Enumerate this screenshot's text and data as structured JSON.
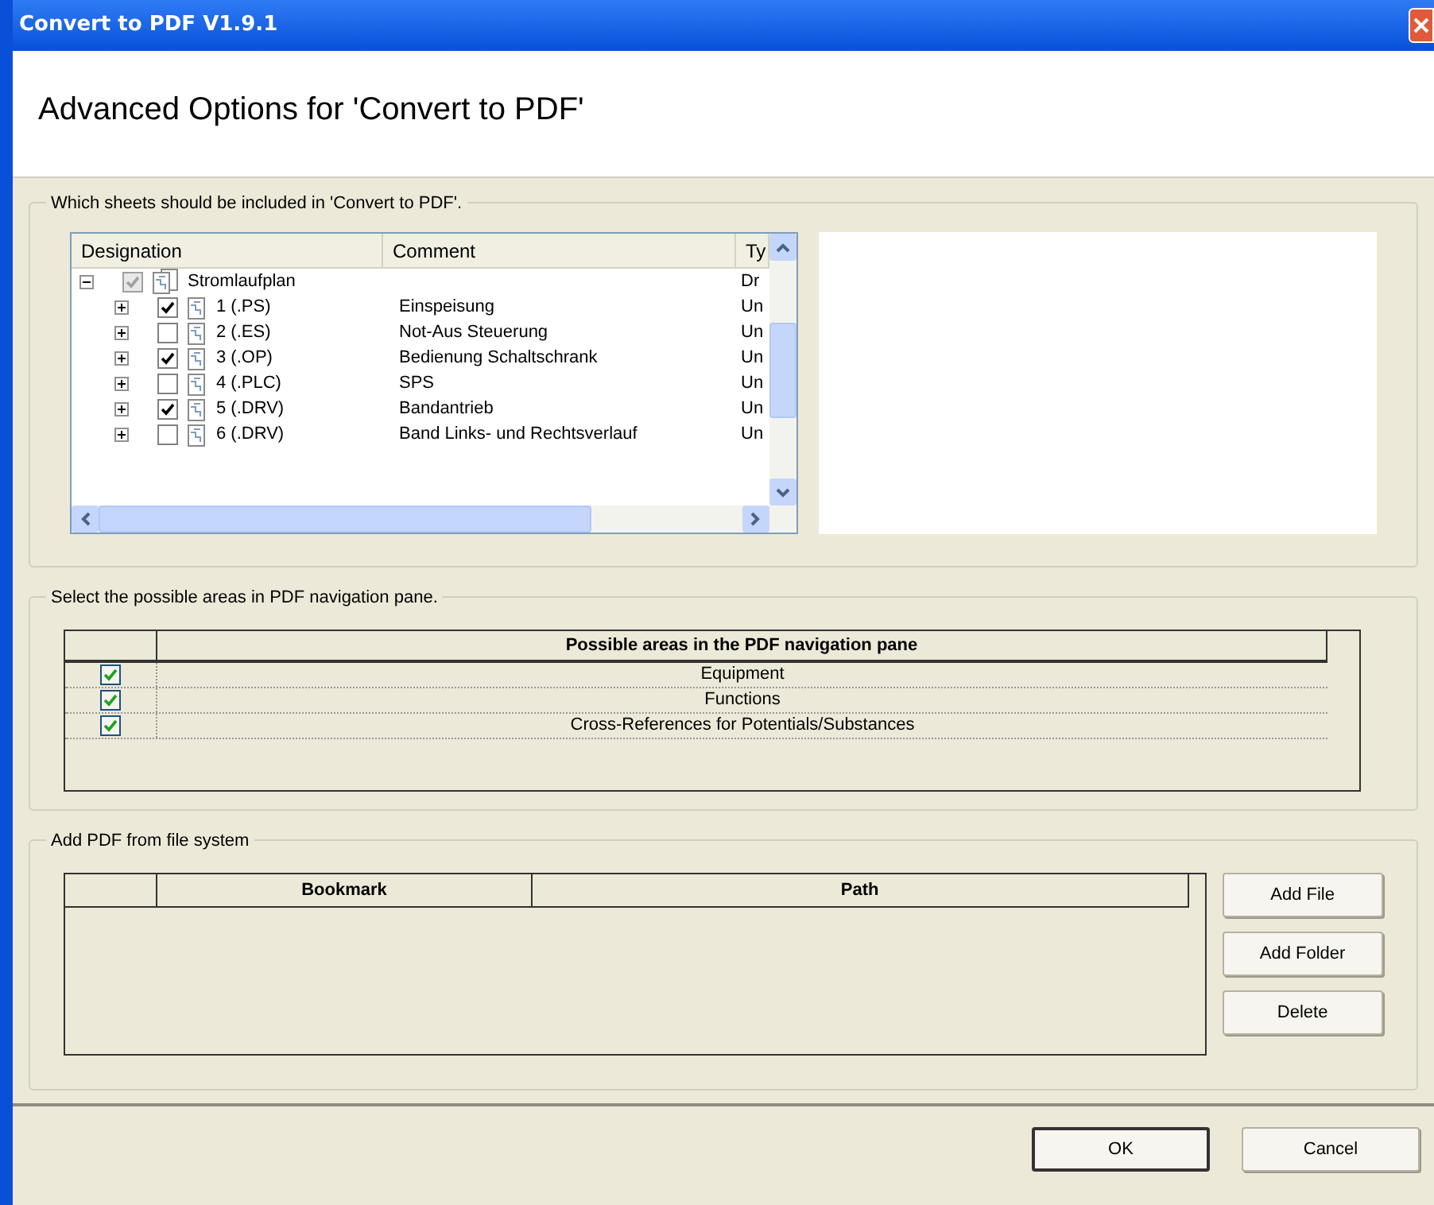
{
  "window": {
    "title": "Convert to PDF V1.9.1"
  },
  "header": {
    "title": "Advanced Options for 'Convert to PDF'"
  },
  "sheets_group": {
    "legend": "Which sheets should be included in 'Convert to PDF'.",
    "columns": [
      "Designation",
      "Comment",
      "Ty"
    ],
    "tree": [
      {
        "label": "Stromlaufplan",
        "type": "Dr",
        "expanded": true,
        "checked": true,
        "grayed": true,
        "children": [
          {
            "label": "1  (.PS)",
            "comment": "Einspeisung",
            "type": "Un",
            "expanded": false,
            "checked": true,
            "grayed": false
          },
          {
            "label": "2  (.ES)",
            "comment": "Not-Aus Steuerung",
            "type": "Un",
            "expanded": false,
            "checked": false,
            "grayed": false
          },
          {
            "label": "3  (.OP)",
            "comment": "Bedienung Schaltschrank",
            "type": "Un",
            "expanded": false,
            "checked": true,
            "grayed": false
          },
          {
            "label": "4  (.PLC)",
            "comment": "SPS",
            "type": "Un",
            "expanded": false,
            "checked": false,
            "grayed": false
          },
          {
            "label": "5  (.DRV)",
            "comment": "Bandantrieb",
            "type": "Un",
            "expanded": false,
            "checked": true,
            "grayed": false
          },
          {
            "label": "6  (.DRV)",
            "comment": "Band Links- und Rechtsverlauf",
            "type": "Un",
            "expanded": false,
            "checked": false,
            "grayed": false
          }
        ]
      }
    ]
  },
  "areas_group": {
    "legend": "Select the possible areas in PDF navigation pane.",
    "column": "Possible areas in the PDF navigation pane",
    "rows": [
      {
        "label": "Equipment",
        "checked": true
      },
      {
        "label": "Functions",
        "checked": true
      },
      {
        "label": "Cross-References for Potentials/Substances",
        "checked": true
      }
    ]
  },
  "files_group": {
    "legend": "Add PDF from file system",
    "columns": [
      "Bookmark",
      "Path"
    ],
    "buttons": [
      "Add File",
      "Add Folder",
      "Delete"
    ]
  },
  "footer": {
    "buttons": [
      {
        "label": "OK",
        "default": true
      },
      {
        "label": "Cancel",
        "default": false
      }
    ]
  }
}
